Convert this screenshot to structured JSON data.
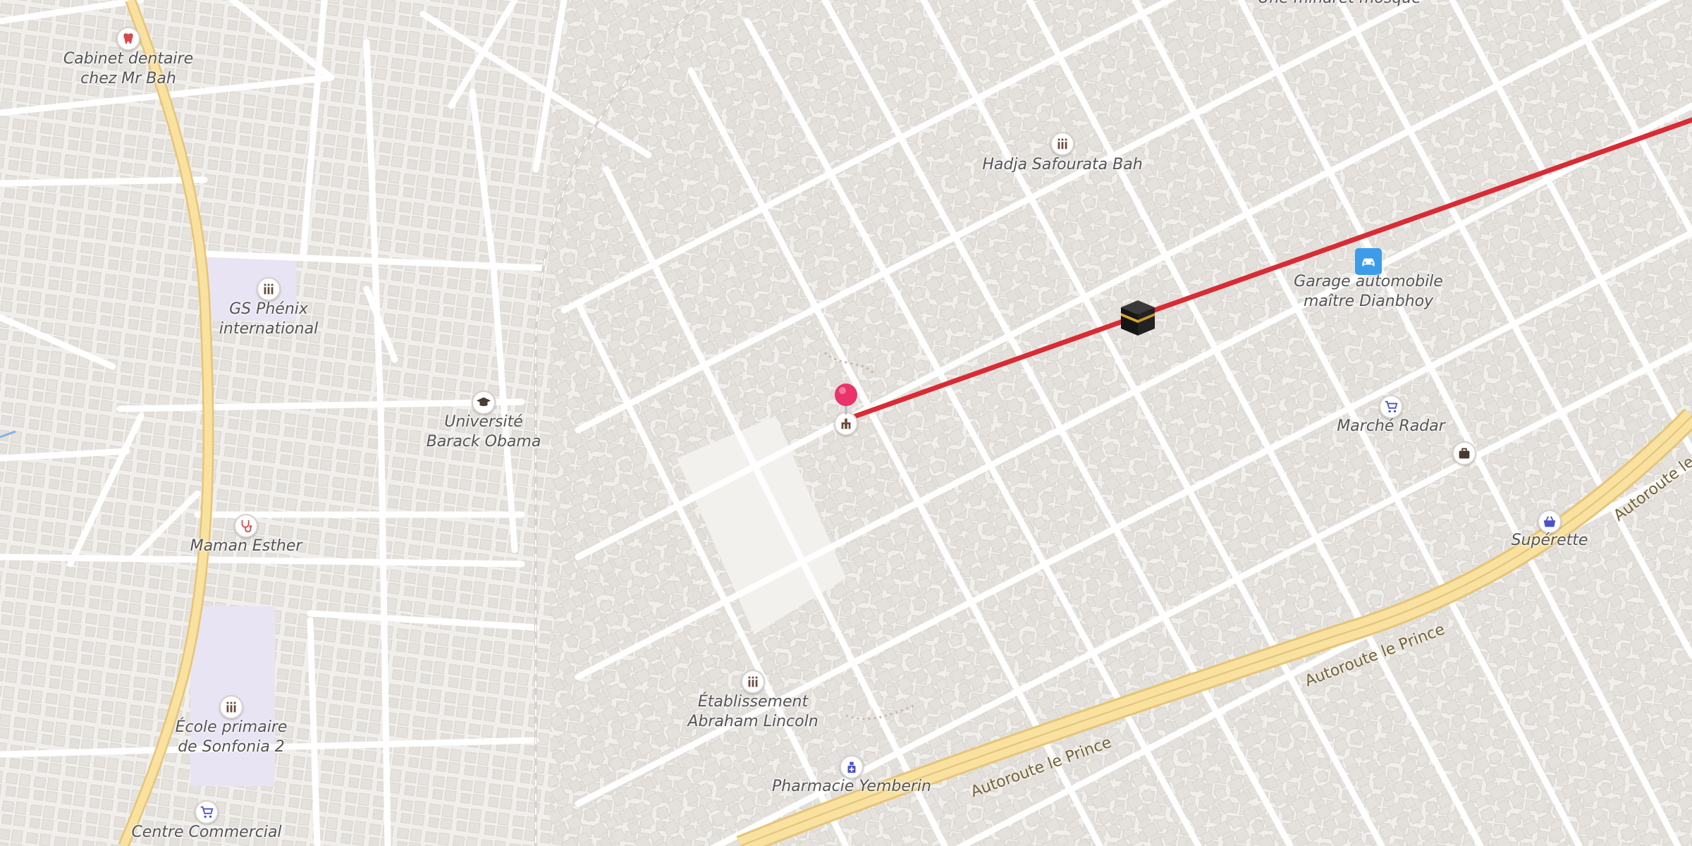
{
  "map": {
    "colors": {
      "background": "#f1efec",
      "route": "#d92b34",
      "highway": "#f6d98e",
      "pin": "#e8336b",
      "car": "#3e9bea"
    },
    "route_line": true
  },
  "labels": {
    "dentist": "Cabinet dentaire\nchez Mr Bah",
    "gs_phenix": "GS Phénix\ninternational",
    "universite": "Université\nBarack Obama",
    "maman_esther": "Maman Esther",
    "ecole_sonfonia": "École primaire\nde Sonfonia 2",
    "centre_commercial": "Centre Commercial",
    "hadja": "Hadja Safourata Bah",
    "garage": "Garage automobile\nmaître Dianbhoy",
    "marche_radar": "Marché Radar",
    "superette": "Supérette",
    "etablissement": "Établissement\nAbraham Lincoln",
    "pharmacie": "Pharmacie Yemberin",
    "top_cut": "Une minaret mosque"
  },
  "roads": {
    "autoroute_1": "Autoroute le Prince",
    "autoroute_2": "Autoroute le Prince",
    "autoroute_3": "Autoroute le"
  },
  "icons": {
    "dentist": "tooth-icon",
    "school": "school-icon",
    "university": "graduation-cap-icon",
    "doctor": "stethoscope-icon",
    "shop": "shopping-cart-icon",
    "car": "car-icon",
    "basket": "shopping-basket-icon",
    "pharmacy": "pharmacy-icon",
    "landmark": "monument-icon",
    "bag": "bag-icon",
    "kaaba": "kaaba-icon",
    "pin": "map-pin-icon"
  }
}
